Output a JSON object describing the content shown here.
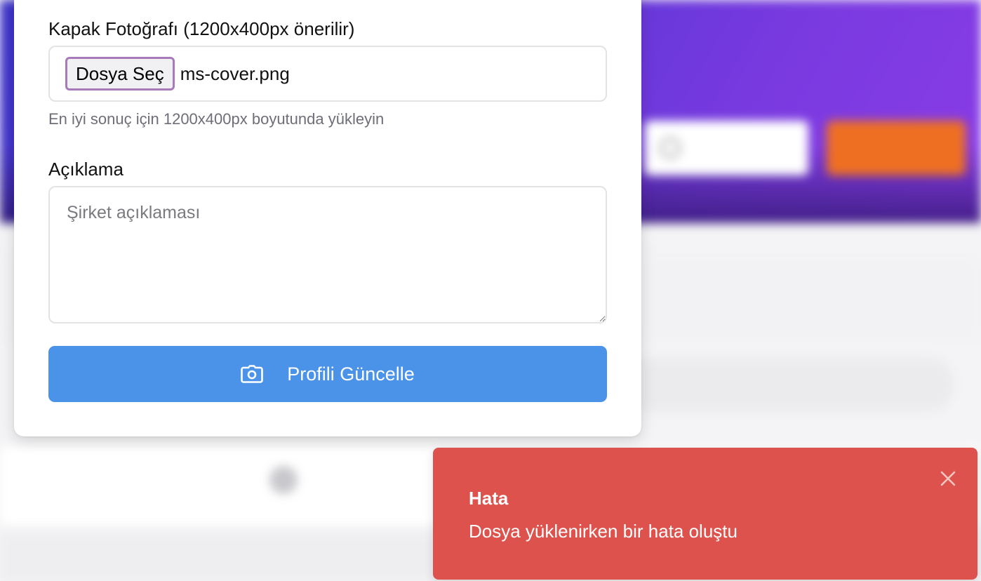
{
  "form": {
    "cover_label": "Kapak Fotoğrafı (1200x400px önerilir)",
    "file_button_label": "Dosya Seç",
    "file_name": "ms-cover.png",
    "cover_help": "En iyi sonuç için 1200x400px boyutunda yükleyin",
    "description_label": "Açıklama",
    "description_placeholder": "Şirket açıklaması",
    "description_value": "",
    "submit_label": "Profili Güncelle",
    "submit_icon": "camera-icon"
  },
  "toast": {
    "title": "Hata",
    "message": "Dosya yüklenirken bir hata oluştu",
    "close_icon": "close-icon"
  },
  "colors": {
    "primary_button": "#4a93e8",
    "toast_error": "#dd524c",
    "file_button_border": "#a87ab9",
    "hero_gradient_start": "#3d33c8",
    "hero_gradient_end": "#8a3be6",
    "contact_button": "#ef6f22"
  }
}
